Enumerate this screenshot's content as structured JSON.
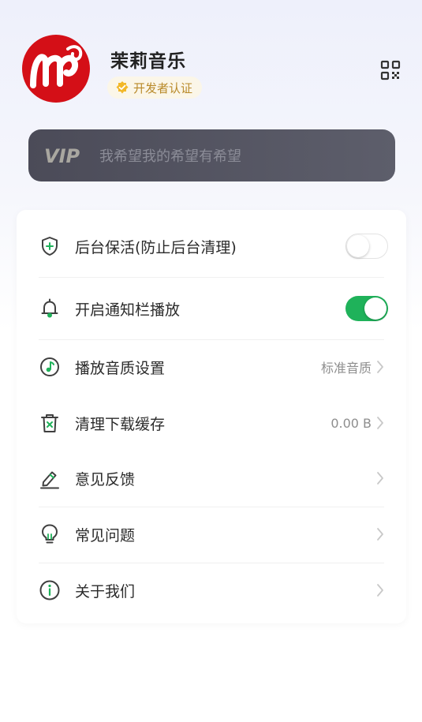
{
  "profile": {
    "app_name": "茉莉音乐",
    "badge_label": "开发者认证"
  },
  "vip": {
    "mark": "VIP",
    "slogan": "我希望我的希望有希望"
  },
  "settings": [
    {
      "label": "后台保活(防止后台清理)",
      "control": "toggle",
      "enabled": false,
      "icon": "shield-plus-icon"
    },
    {
      "label": "开启通知栏播放",
      "control": "toggle",
      "enabled": true,
      "icon": "bell-icon"
    },
    {
      "label": "播放音质设置",
      "value": "标准音质",
      "icon": "music-note-icon"
    },
    {
      "label": "清理下载缓存",
      "value": "0.00 B",
      "icon": "trash-icon"
    },
    {
      "label": "意见反馈",
      "icon": "pencil-icon"
    },
    {
      "label": "常见问题",
      "icon": "lightbulb-icon"
    },
    {
      "label": "关于我们",
      "icon": "info-icon"
    }
  ],
  "colors": {
    "brand_red": "#d40f17",
    "toggle_on": "#1fb25a",
    "icon_stroke": "#3f3f3f",
    "icon_accent": "#1fb25a",
    "badge_gold": "#b98a2a",
    "vip_bg": "#4b4b58"
  }
}
